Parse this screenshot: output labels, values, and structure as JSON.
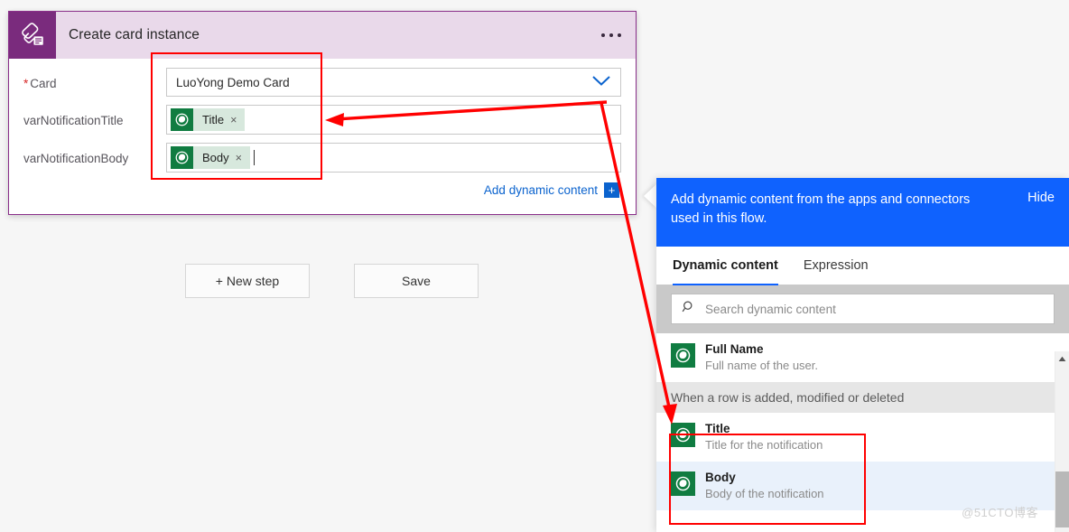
{
  "action_card": {
    "icon_name": "power-cards-icon",
    "title": "Create card instance",
    "overflow_label": "More commands",
    "fields": [
      {
        "label": "Card",
        "required": true,
        "required_marker": "*",
        "type": "combobox",
        "value": "LuoYong Demo Card",
        "chevron": "chevron-down"
      },
      {
        "label": "varNotificationTitle",
        "required": false,
        "type": "token-input",
        "token": {
          "label": "Title",
          "remove": "×",
          "icon_name": "dataverse-icon"
        },
        "caret": false
      },
      {
        "label": "varNotificationBody",
        "required": false,
        "type": "token-input",
        "token": {
          "label": "Body",
          "remove": "×",
          "icon_name": "dataverse-icon"
        },
        "caret": true
      }
    ],
    "add_dynamic_content": {
      "label": "Add dynamic content",
      "plus": "+"
    }
  },
  "buttons": [
    {
      "label": "+ New step",
      "name": "new-step-button"
    },
    {
      "label": "Save",
      "name": "save-button"
    }
  ],
  "dynamic_panel": {
    "banner": {
      "text": "Add dynamic content from the apps and connectors used in this flow.",
      "hide_label": "Hide",
      "bg": "#0f62fe"
    },
    "tabs": [
      {
        "label": "Dynamic content",
        "active": true
      },
      {
        "label": "Expression",
        "active": false
      }
    ],
    "search": {
      "placeholder": "Search dynamic content",
      "icon_name": "search-icon",
      "value": ""
    },
    "items_before_group": [
      {
        "name": "Full Name",
        "description": "Full name of the user.",
        "icon_name": "dataverse-icon",
        "selected": false
      }
    ],
    "group_header": "When a row is added, modified or deleted",
    "items_after_group": [
      {
        "name": "Title",
        "description": "Title for the notification",
        "icon_name": "dataverse-icon",
        "selected": false
      },
      {
        "name": "Body",
        "description": "Body of the notification",
        "icon_name": "dataverse-icon",
        "selected": true
      }
    ],
    "scrollbar": {
      "up_arrow": "▲"
    }
  },
  "annotations": {
    "highlight_color": "#ff0000",
    "boxes": [
      {
        "name": "left-token-fields-highlight"
      },
      {
        "name": "right-title-body-items-highlight"
      }
    ],
    "arrows": [
      {
        "name": "arrow-to-title-token"
      },
      {
        "name": "arrow-to-group-header"
      }
    ]
  },
  "watermark": "@51CTO博客"
}
